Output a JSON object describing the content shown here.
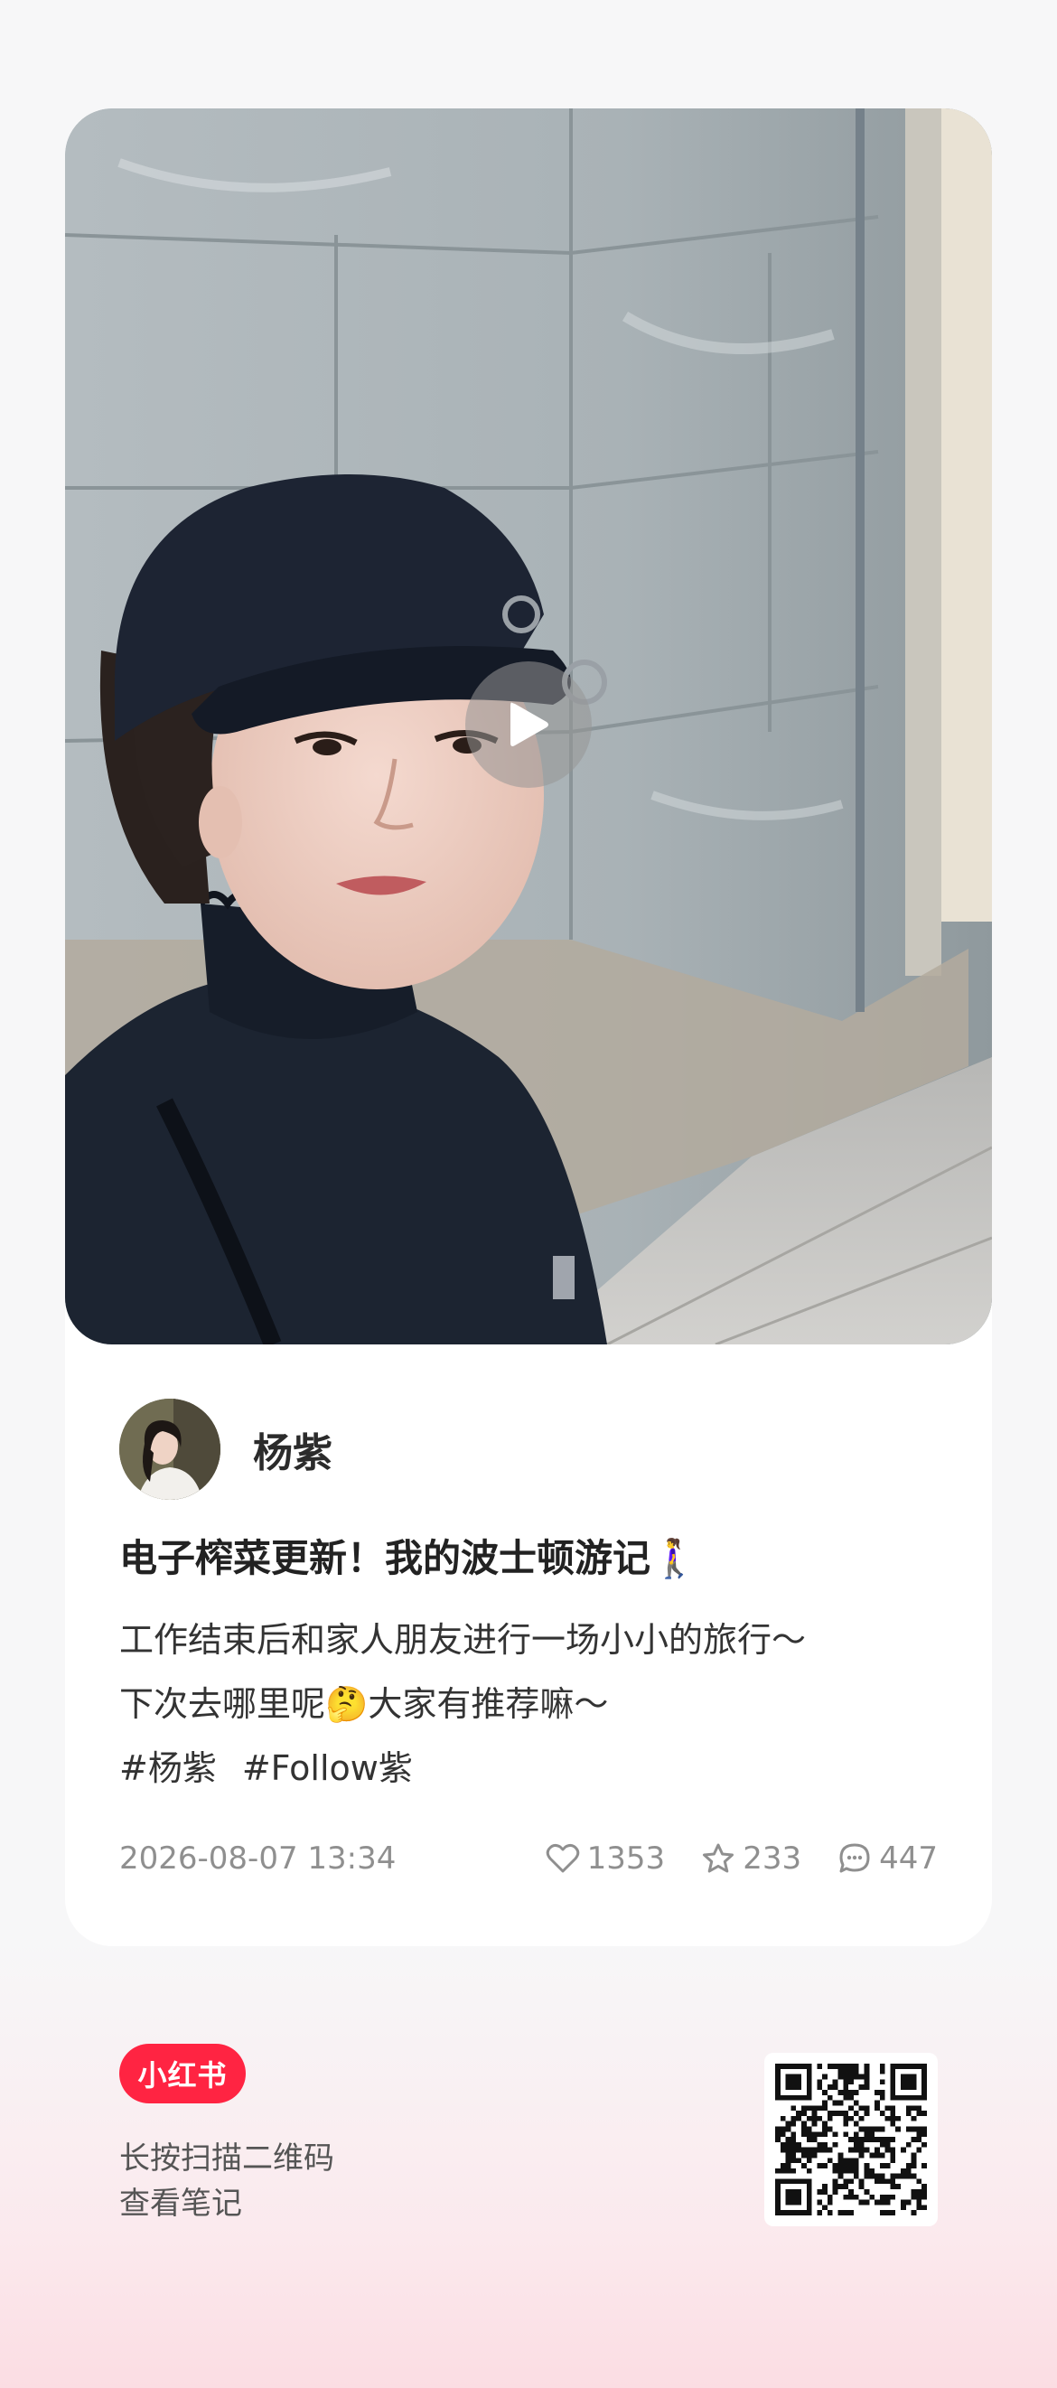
{
  "author": {
    "name": "杨紫"
  },
  "note": {
    "title": "电子榨菜更新！我的波士顿游记🚶‍♀️",
    "body_lines": [
      "工作结束后和家人朋友进行一场小小的旅行～",
      "下次去哪里呢🤔大家有推荐嘛～"
    ],
    "tags": [
      "#杨紫",
      "#Follow紫"
    ]
  },
  "meta": {
    "date": "2026-08-07 13:34",
    "likes": "1353",
    "collects": "233",
    "comments": "447"
  },
  "footer": {
    "brand": "小红书",
    "scan_hint_lines": [
      "长按扫描二维码",
      "查看笔记"
    ]
  },
  "icons": {
    "play": "play-icon",
    "like": "heart-icon",
    "collect": "star-icon",
    "comment": "comment-icon"
  },
  "colors": {
    "brand": "#ff2442",
    "meta_text": "#8f8f8f"
  }
}
